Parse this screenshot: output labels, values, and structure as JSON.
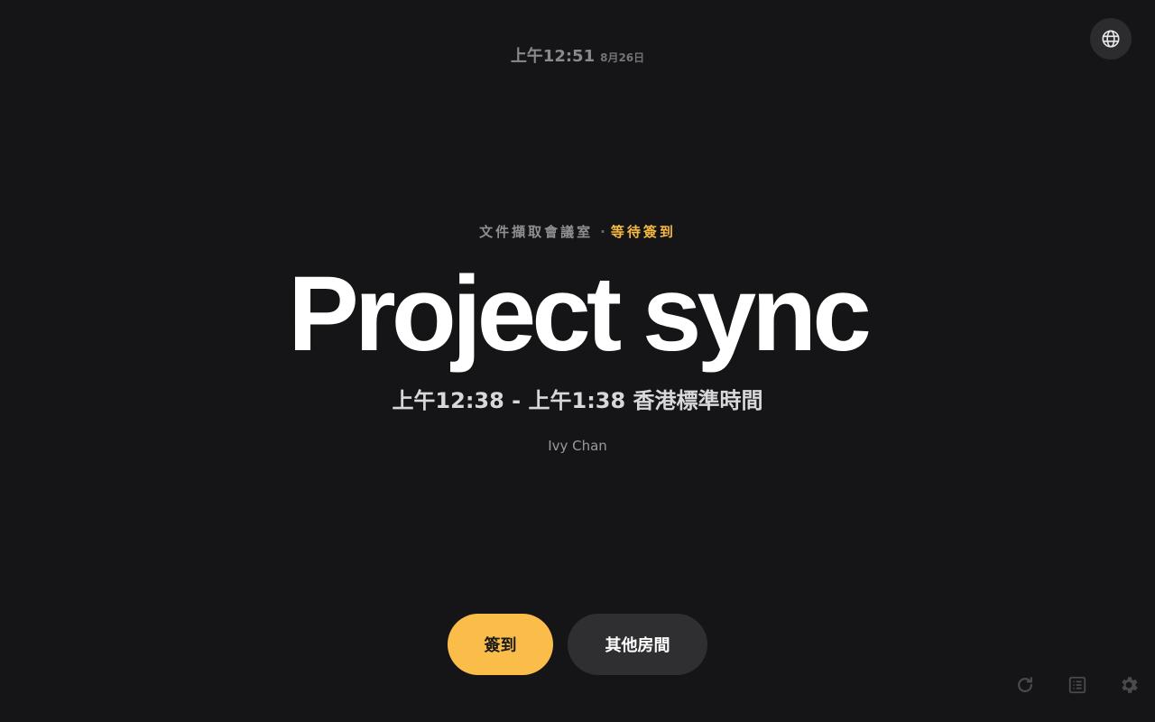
{
  "header": {
    "time": "上午12:51",
    "date": "8月26日"
  },
  "language_button": {
    "icon": "globe-icon"
  },
  "meeting": {
    "room": "文件擷取會議室",
    "separator": "·",
    "status": "等待簽到",
    "title": "Project sync",
    "time_range": "上午12:38 - 上午1:38 香港標準時間",
    "organizer": "Ivy Chan"
  },
  "actions": {
    "checkin_label": "簽到",
    "other_rooms_label": "其他房間"
  },
  "toolbar": {
    "refresh_icon": "refresh-icon",
    "list_icon": "list-icon",
    "settings_icon": "gear-icon"
  },
  "colors": {
    "background": "#151517",
    "accent": "#fbbd4a",
    "status": "#f5b942",
    "secondary_button": "#2f2f32"
  }
}
